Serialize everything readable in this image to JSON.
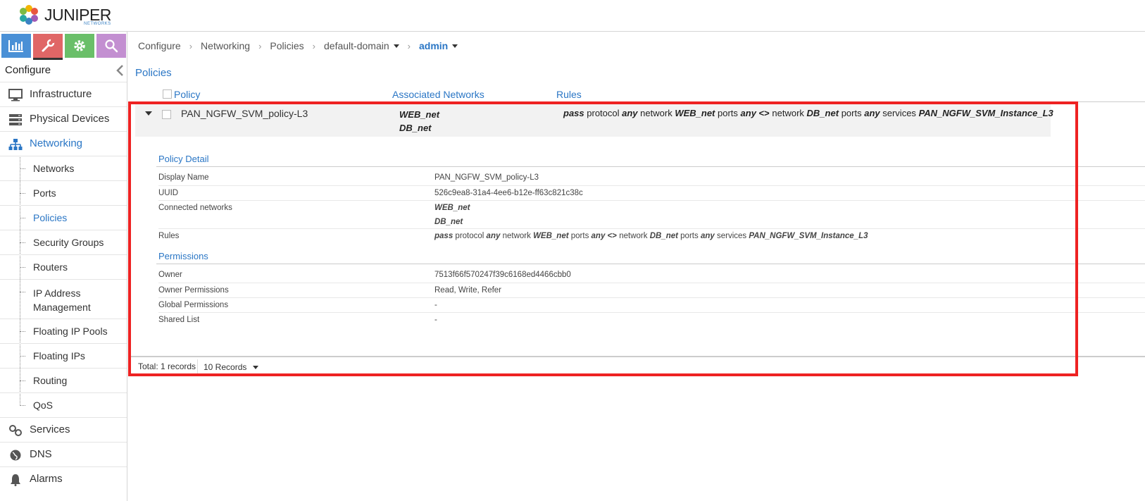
{
  "brand": {
    "name": "JUNIPER",
    "sub": "NETWORKS"
  },
  "colors": {
    "accent": "#2a76c5",
    "highlight": "#ee2222",
    "monitor": "#4a90d6",
    "configure": "#e06666",
    "settings": "#6abf69",
    "query": "#c38fd1"
  },
  "mode_buttons": [
    {
      "icon": "bar-chart-icon"
    },
    {
      "icon": "wrench-icon"
    },
    {
      "icon": "gear-icon"
    },
    {
      "icon": "search-icon"
    }
  ],
  "sidebar": {
    "title": "Configure",
    "items": [
      {
        "label": "Infrastructure",
        "icon": "monitor-icon"
      },
      {
        "label": "Physical Devices",
        "icon": "server-icon"
      },
      {
        "label": "Networking",
        "icon": "network-tree-icon"
      }
    ],
    "sub_items": [
      {
        "label": "Networks"
      },
      {
        "label": "Ports"
      },
      {
        "label": "Policies"
      },
      {
        "label": "Security Groups"
      },
      {
        "label": "Routers"
      },
      {
        "label": "IP Address Management"
      },
      {
        "label": "Floating IP Pools"
      },
      {
        "label": "Floating IPs"
      },
      {
        "label": "Routing"
      },
      {
        "label": "QoS"
      }
    ],
    "bottom_items": [
      {
        "label": "Services",
        "icon": "link-icon"
      },
      {
        "label": "DNS",
        "icon": "globe-icon"
      },
      {
        "label": "Alarms",
        "icon": "bell-icon"
      }
    ]
  },
  "breadcrumb": {
    "items": [
      "Configure",
      "Networking",
      "Policies"
    ],
    "domain": "default-domain",
    "project": "admin"
  },
  "page": {
    "title": "Policies"
  },
  "grid": {
    "columns": [
      "Policy",
      "Associated Networks",
      "Rules"
    ],
    "row": {
      "policy": "PAN_NGFW_SVM_policy-L3",
      "networks": [
        "WEB_net",
        "DB_net"
      ],
      "rule": {
        "action": "pass",
        "w_protocol": "protocol",
        "protocol": "any",
        "w_network": "network",
        "src_net": "WEB_net",
        "w_ports": "ports",
        "src_ports": "any",
        "direction": "<>",
        "w_network2": "network",
        "dst_net": "DB_net",
        "w_ports2": "ports",
        "dst_ports": "any",
        "w_services": "services",
        "service": "PAN_NGFW_SVM_Instance_L3"
      }
    }
  },
  "detail": {
    "policy_title": "Policy Detail",
    "display_name_label": "Display Name",
    "display_name": "PAN_NGFW_SVM_policy-L3",
    "uuid_label": "UUID",
    "uuid": "526c9ea8-31a4-4ee6-b12e-ff63c821c38c",
    "connected_label": "Connected networks",
    "connected": [
      "WEB_net",
      "DB_net"
    ],
    "rules_label": "Rules",
    "permissions_title": "Permissions",
    "owner_label": "Owner",
    "owner": "7513f66f570247f39c6168ed4466cbb0",
    "owner_perms_label": "Owner Permissions",
    "owner_perms": "Read, Write, Refer",
    "global_perms_label": "Global Permissions",
    "global_perms": "-",
    "shared_label": "Shared List",
    "shared": "-"
  },
  "footer": {
    "total": "Total: 1 records",
    "page_size": "10 Records"
  }
}
